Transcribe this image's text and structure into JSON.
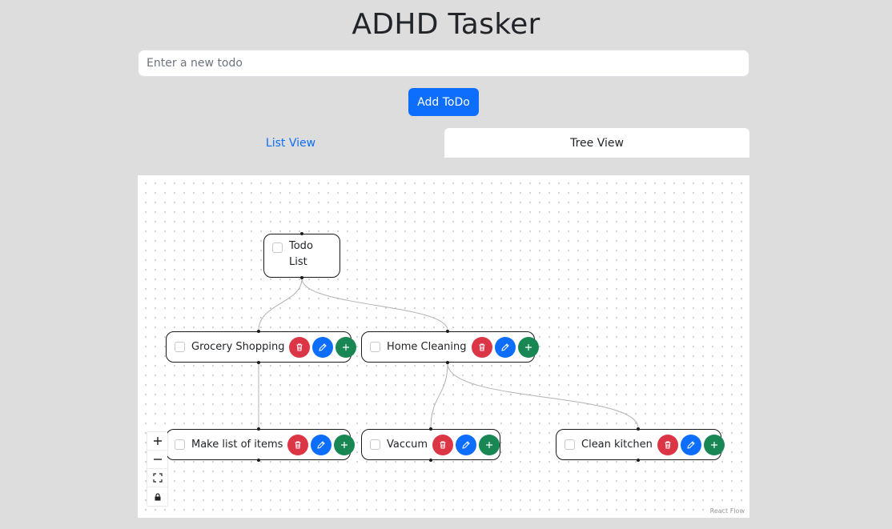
{
  "app": {
    "title": "ADHD Tasker"
  },
  "input": {
    "placeholder": "Enter a new todo",
    "value": ""
  },
  "buttons": {
    "add_label": "Add ToDo"
  },
  "tabs": [
    {
      "label": "List View",
      "active": false
    },
    {
      "label": "Tree View",
      "active": true
    }
  ],
  "tree": {
    "root": {
      "label": "Todo List",
      "checked": false
    },
    "nodes": [
      {
        "label": "Grocery Shopping",
        "checked": false,
        "parent": "Todo List"
      },
      {
        "label": "Home Cleaning",
        "checked": false,
        "parent": "Todo List"
      },
      {
        "label": "Make list of items",
        "checked": false,
        "parent": "Grocery Shopping"
      },
      {
        "label": "Vaccum",
        "checked": false,
        "parent": "Home Cleaning"
      },
      {
        "label": "Clean kitchen",
        "checked": false,
        "parent": "Home Cleaning"
      }
    ],
    "node_actions": [
      "trash-icon",
      "pencil-icon",
      "plus-icon"
    ]
  },
  "flow_controls": [
    "zoom-in-icon",
    "zoom-out-icon",
    "fit-view-icon",
    "lock-icon"
  ],
  "attribution": "React Flow",
  "colors": {
    "primary": "#0d6efd",
    "danger": "#dc3545",
    "success": "#198754",
    "background": "#dddddd"
  }
}
